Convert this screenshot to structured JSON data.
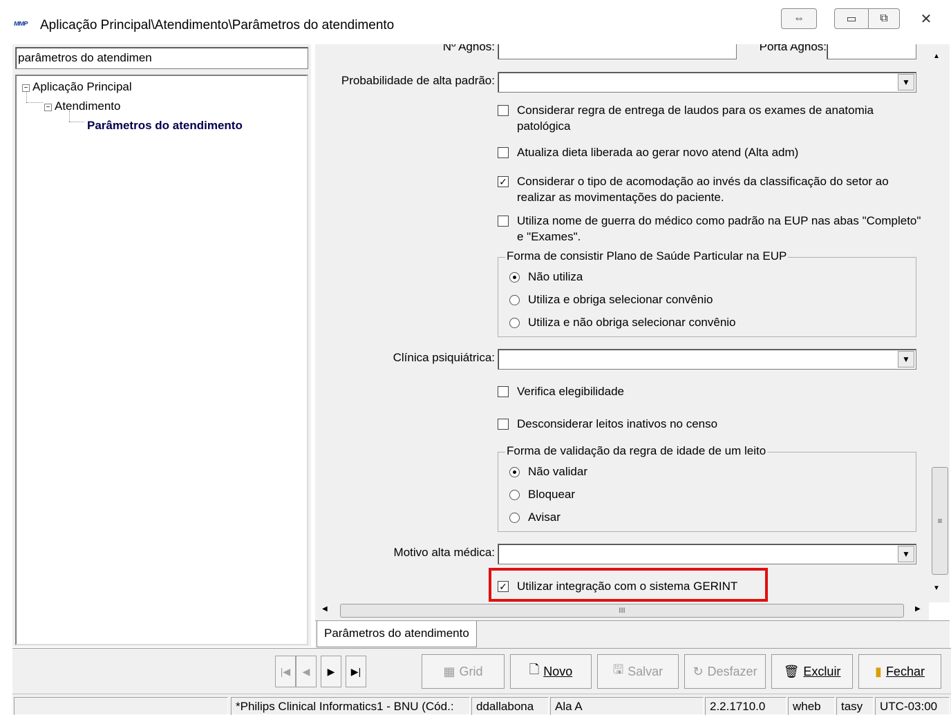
{
  "window": {
    "icon_text": "ᴍᴍᴘ",
    "title": "Aplicação Principal\\Atendimento\\Parâmetros do atendimento",
    "restore_glyph": "⇔",
    "minimize_glyph": "▭",
    "maximize_glyph": "⧉",
    "close_glyph": "✕"
  },
  "search": {
    "value": "parâmetros do atendimen"
  },
  "tree": {
    "root": "Aplicação Principal",
    "child": "Atendimento",
    "leaf": "Parâmetros do atendimento"
  },
  "form": {
    "top_cut_label_left": "Nº Agnos:",
    "top_cut_label_right": "Porta Agnos:",
    "prob_alta_label": "Probabilidade de alta padrão:",
    "prob_alta_value": "",
    "chk_laudos": "Considerar regra de entrega de laudos para os exames de anatomia patológica",
    "chk_laudos_checked": false,
    "chk_dieta": "Atualiza dieta liberada ao gerar novo atend (Alta adm)",
    "chk_dieta_checked": false,
    "chk_acomodacao": "Considerar o tipo de acomodação ao invés da classificação do setor ao realizar as movimentações do paciente.",
    "chk_acomodacao_checked": true,
    "chk_guerra": "Utiliza nome de guerra do médico como padrão na EUP nas abas \"Completo\" e \"Exames\".",
    "chk_guerra_checked": false,
    "group_plano": {
      "title": "Forma de consistir Plano de Saúde Particular na EUP",
      "options": [
        "Não utiliza",
        "Utiliza e obriga selecionar convênio",
        "Utiliza e não obriga selecionar convênio"
      ],
      "selected": 0
    },
    "clinica_label": "Clínica psiquiátrica:",
    "clinica_value": "",
    "chk_elegibilidade": "Verifica elegibilidade",
    "chk_elegibilidade_checked": false,
    "chk_leitos": "Desconsiderar leitos inativos no censo",
    "chk_leitos_checked": false,
    "group_idade": {
      "title": "Forma de validação da regra de idade de um leito",
      "options": [
        "Não validar",
        "Bloquear",
        "Avisar"
      ],
      "selected": 0
    },
    "motivo_label": "Motivo alta médica:",
    "motivo_value": "",
    "chk_gerint": "Utilizar integração com o sistema GERINT",
    "chk_gerint_checked": true,
    "highlight_color": "#e01010"
  },
  "tabs": {
    "active": "Parâmetros do atendimento"
  },
  "toolbar": {
    "first": "|◀",
    "prev": "◀",
    "next": "▶",
    "last": "▶|",
    "grid": "Grid",
    "novo": "Novo",
    "salvar": "Salvar",
    "desfazer": "Desfazer",
    "excluir": "Excluir",
    "fechar": "Fechar"
  },
  "status": {
    "company": "*Philips Clinical Informatics1 - BNU (Cód.:",
    "user": "ddallabona",
    "ala": "Ala A",
    "version": "2.2.1710.0",
    "db_user": "wheb",
    "schema": "tasy",
    "timezone": "UTC-03:00"
  },
  "scrollbar": {
    "hscroll_grip": "III",
    "vscroll_grip": "≡"
  }
}
